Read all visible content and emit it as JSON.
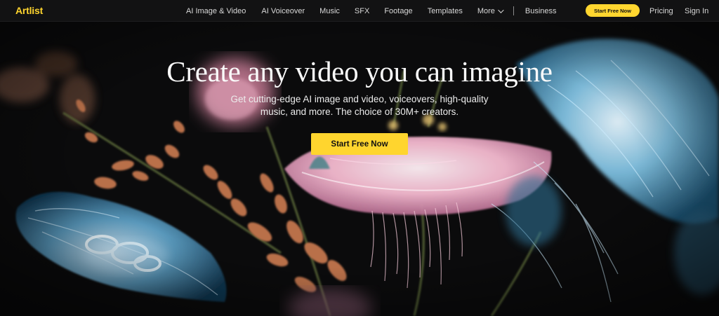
{
  "brand": {
    "logo_text": "Artlist",
    "accent_color": "#ffd52e"
  },
  "nav": {
    "links": [
      {
        "label": "AI Image & Video"
      },
      {
        "label": "AI Voiceover"
      },
      {
        "label": "Music"
      },
      {
        "label": "SFX"
      },
      {
        "label": "Footage"
      },
      {
        "label": "Templates"
      },
      {
        "label": "More"
      }
    ],
    "business_label": "Business",
    "cta_label": "Start Free Now",
    "pricing_label": "Pricing",
    "signin_label": "Sign In"
  },
  "hero": {
    "headline": "Create any video you can imagine",
    "subtext_line1": "Get cutting-edge AI image and video, voiceovers, high-quality",
    "subtext_line2": "music, and more. The choice of 30M+ creators.",
    "cta_label": "Start Free Now",
    "background_image": "ethereal translucent jellyfish-like flowers on dark background"
  }
}
